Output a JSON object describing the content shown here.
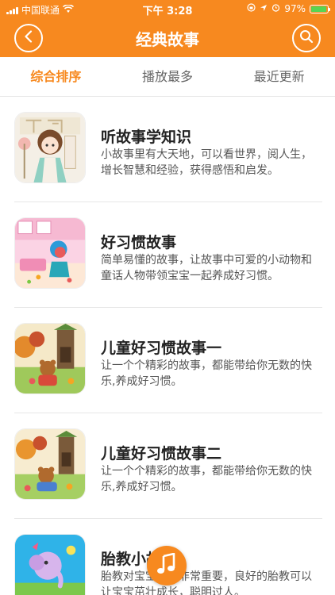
{
  "status_bar": {
    "carrier": "中国联通",
    "time": "下午 3:28",
    "battery": "97%",
    "battery_level": 0.97
  },
  "nav": {
    "title": "经典故事",
    "back_icon": "back-chevron-icon",
    "search_icon": "search-icon"
  },
  "tabs": [
    {
      "label": "综合排序",
      "active": true
    },
    {
      "label": "播放最多",
      "active": false
    },
    {
      "label": "最近更新",
      "active": false
    }
  ],
  "stories": [
    {
      "title": "听故事学知识",
      "desc": "小故事里有大天地，可以看世界，阅人生，增长智慧和经验，获得感悟和启发。",
      "thumb": "girl-scholar"
    },
    {
      "title": "好习惯故事",
      "desc": "简单易懂的故事，让故事中可爱的小动物和童话人物带领宝宝一起养成好习惯。",
      "thumb": "pink-room"
    },
    {
      "title": "儿童好习惯故事一",
      "desc": "让一个个精彩的故事，都能带给你无数的快乐,养成好习惯。",
      "thumb": "forest-bear"
    },
    {
      "title": "儿童好习惯故事二",
      "desc": "让一个个精彩的故事，都能带给你无数的快乐,养成好习惯。",
      "thumb": "forest-bear-2"
    },
    {
      "title": "胎教小故事",
      "desc": "胎教对宝宝成长非常重要，良好的胎教可以让宝宝茁壮成长，聪明过人。",
      "thumb": "elephant"
    }
  ],
  "colors": {
    "accent": "#f7891f",
    "battery_fill": "#59d453"
  }
}
